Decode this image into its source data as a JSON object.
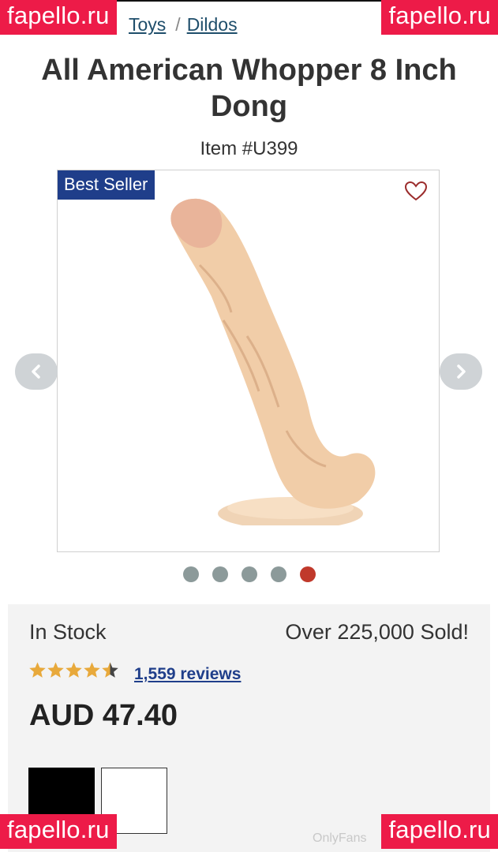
{
  "breadcrumb": {
    "toys": "Toys",
    "sep": "/",
    "dildos": "Dildos"
  },
  "product": {
    "title_line1": "All American Whopper 8 Inch",
    "title_line2": "Dong",
    "item_number": "Item #U399",
    "badge": "Best Seller",
    "image_count": 5,
    "active_image": 5
  },
  "availability": {
    "stock": "In Stock",
    "sold": "Over 225,000 Sold!"
  },
  "rating": {
    "stars": 4.5,
    "reviews": "1,559 reviews"
  },
  "price": "AUD 47.40",
  "swatches": [
    "black",
    "white"
  ],
  "watermarks": {
    "site": "fapello.ru",
    "bottom_text": "OnlyFans"
  },
  "colors": {
    "badge": "#1f3e8a",
    "accent": "#c0392b",
    "watermark": "#ed1b48",
    "link": "#1f4e6b",
    "star": "#e8a93b"
  }
}
